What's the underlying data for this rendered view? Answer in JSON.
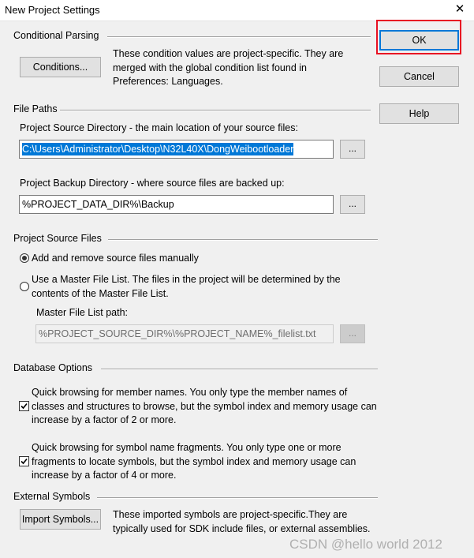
{
  "window": {
    "title": "New Project Settings",
    "close_glyph": "✕"
  },
  "buttons": {
    "ok": "OK",
    "cancel": "Cancel",
    "help": "Help"
  },
  "conditional_parsing": {
    "heading": "Conditional Parsing",
    "conditions_button": "Conditions...",
    "description": "These condition values are project-specific.  They are merged with the global condition list found in Preferences: Languages."
  },
  "file_paths": {
    "heading": "File Paths",
    "source_dir_label": "Project Source Directory - the main location of your source files:",
    "source_dir_value": "C:\\Users\\Administrator\\Desktop\\N32L40X\\DongWeibootloader",
    "backup_dir_label": "Project Backup Directory - where source files are backed up:",
    "backup_dir_value": "%PROJECT_DATA_DIR%\\Backup",
    "browse_label": "..."
  },
  "source_files": {
    "heading": "Project Source Files",
    "option_manual": "Add and remove source files manually",
    "option_master": "Use a Master File List. The files in the project will be determined by the contents of the Master File List.",
    "master_path_label": "Master File List path:",
    "master_path_value": "%PROJECT_SOURCE_DIR%\\%PROJECT_NAME%_filelist.txt",
    "selected_option": "manual"
  },
  "database_options": {
    "heading": "Database Options",
    "member_names": "Quick browsing for member names.  You only type the member names of classes and structures to browse, but the symbol index and memory usage can increase by a factor of 2 or more.",
    "member_names_checked": true,
    "symbol_fragments": "Quick browsing for symbol name fragments.  You only type one or more fragments to locate symbols, but the symbol index and memory usage can increase by a factor of 4 or more.",
    "symbol_fragments_checked": true
  },
  "external_symbols": {
    "heading": "External Symbols",
    "import_button": "Import Symbols...",
    "description": "These imported symbols are project-specific.They are typically used for SDK include files, or external assemblies."
  },
  "watermark": "CSDN @hello world 2012",
  "colors": {
    "highlight": "#e81123",
    "selection": "#0078d7",
    "background": "#f0f0f0"
  }
}
